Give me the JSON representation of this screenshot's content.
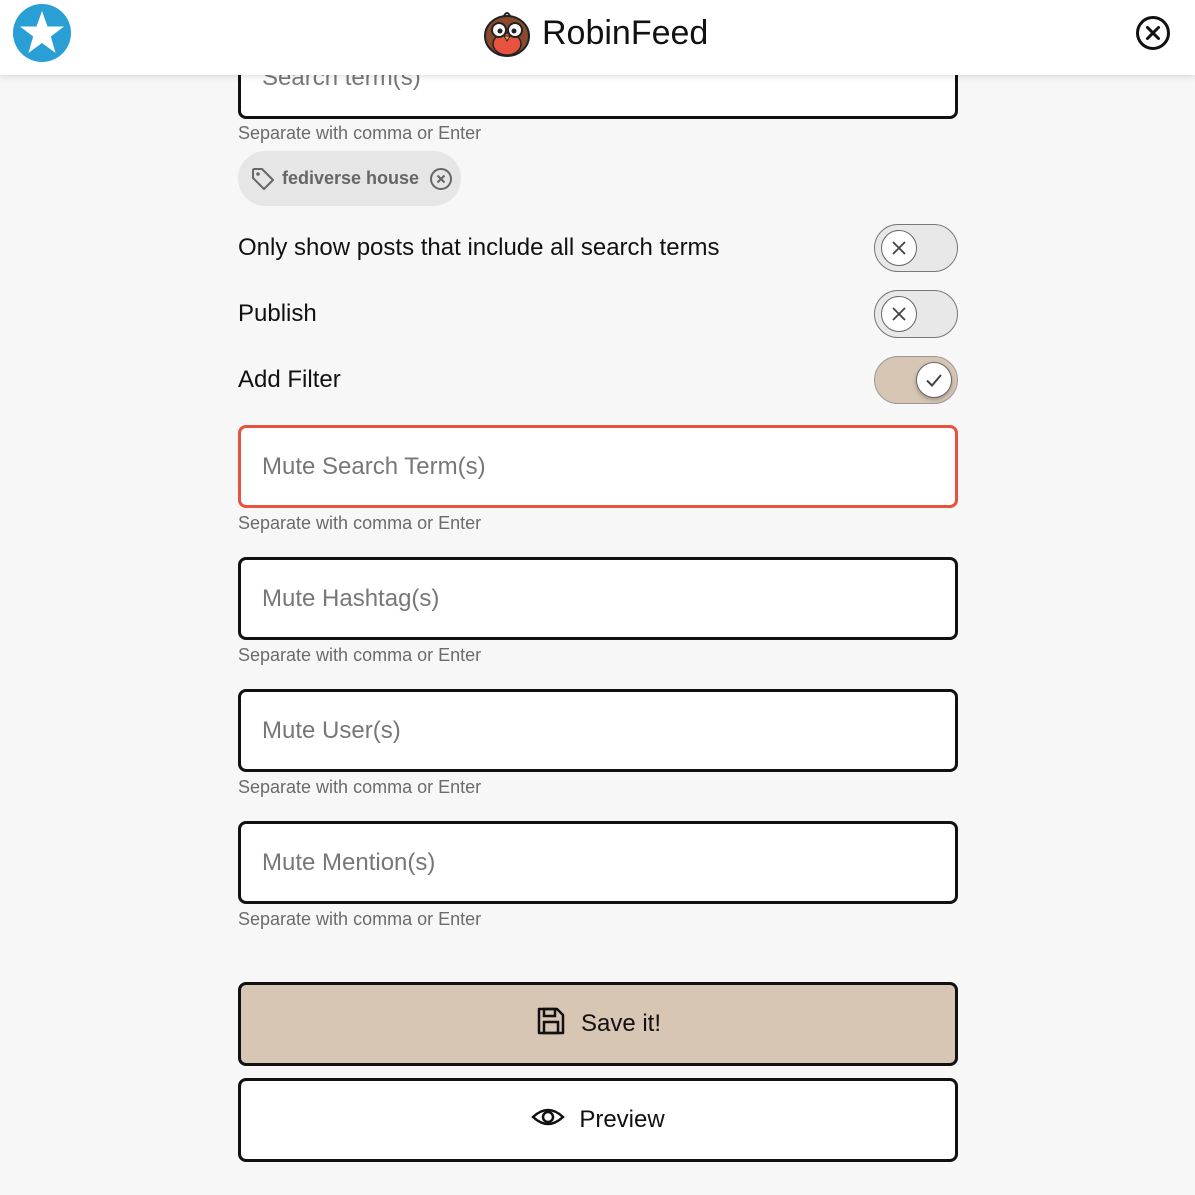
{
  "header": {
    "app_title": "RobinFeed",
    "star_icon": "star-icon",
    "close_icon": "close-icon",
    "colors": {
      "star": "#2a9fd6",
      "background": "#ffffff"
    }
  },
  "search": {
    "placeholder": "Search term(s)",
    "hint": "Separate with comma or Enter",
    "chips": [
      {
        "label": "fediverse house"
      }
    ]
  },
  "toggles": {
    "all_terms": {
      "label": "Only show posts that include all search terms",
      "on": false
    },
    "publish": {
      "label": "Publish",
      "on": false
    },
    "add_filter": {
      "label": "Add Filter",
      "on": true
    }
  },
  "filters": {
    "mute_terms": {
      "placeholder": "Mute Search Term(s)",
      "hint": "Separate with comma or Enter"
    },
    "mute_hashtags": {
      "placeholder": "Mute Hashtag(s)",
      "hint": "Separate with comma or Enter"
    },
    "mute_users": {
      "placeholder": "Mute User(s)",
      "hint": "Separate with comma or Enter"
    },
    "mute_mentions": {
      "placeholder": "Mute Mention(s)",
      "hint": "Separate with comma or Enter"
    }
  },
  "actions": {
    "save_label": "Save it!",
    "preview_label": "Preview"
  },
  "colors": {
    "accent": "#d7c6b4",
    "error_border": "#e8533f",
    "page_bg": "#f7f7f7"
  }
}
